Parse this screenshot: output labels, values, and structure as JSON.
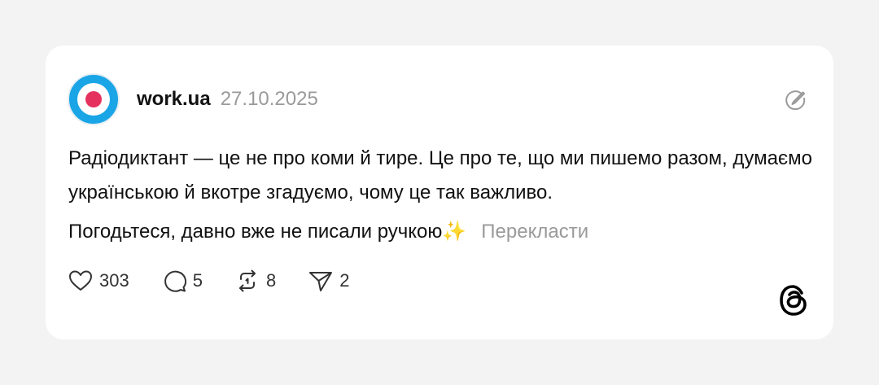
{
  "post": {
    "username": "work.ua",
    "date": "27.10.2025",
    "text_line1": "Радіодиктант — це не про коми й тире. Це про те, що ми пишемо разом, думаємо українською й вкотре згадуємо, чому це так важливо.",
    "text_line2": "Погодьтеся, давно вже не писали ручкою✨",
    "translate_label": "Перекласти"
  },
  "actions": {
    "likes": "303",
    "comments": "5",
    "reposts": "8",
    "shares": "2"
  },
  "icons": {
    "like": "heart-icon",
    "comment": "speech-bubble-icon",
    "repost": "repost-arrows-icon",
    "share": "paper-plane-icon",
    "edit": "edit-pencil-circle-icon",
    "brand": "threads-logo-icon"
  },
  "colors": {
    "avatar_outer": "#1aa5e6",
    "avatar_dot": "#e5315e",
    "muted_text": "#9a9a9a",
    "card_bg": "#ffffff",
    "page_bg": "#f3f3f3"
  }
}
